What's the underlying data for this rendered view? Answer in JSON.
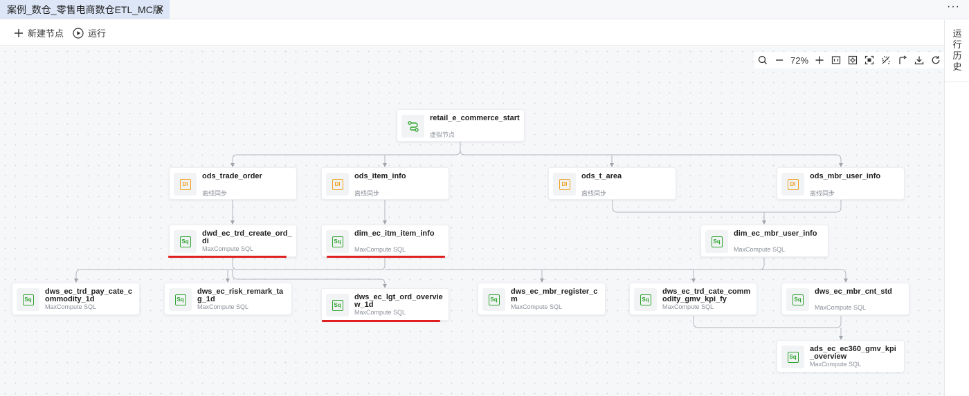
{
  "tab": {
    "title": "案例_数仓_零售电商数仓ETL_MC版",
    "close": "✕"
  },
  "more_label": "···",
  "toolbar": {
    "new_node": "新建节点",
    "run": "运行"
  },
  "right_panel": {
    "history_chars": [
      "运",
      "行",
      "历",
      "史"
    ]
  },
  "zoom": {
    "level": "72%"
  },
  "nodes": {
    "start": {
      "name": "retail_e_commerce_start",
      "type": "虚拟节点",
      "icon": "virtual-node-icon"
    },
    "ods_trade_order": {
      "name": "ods_trade_order",
      "type": "离线同步",
      "icon": "DI"
    },
    "ods_item_info": {
      "name": "ods_item_info",
      "type": "离线同步",
      "icon": "DI"
    },
    "ods_t_area": {
      "name": "ods_t_area",
      "type": "离线同步",
      "icon": "DI"
    },
    "ods_mbr_user_info": {
      "name": "ods_mbr_user_info",
      "type": "离线同步",
      "icon": "DI"
    },
    "dwd_ec_trd_create_ord_di": {
      "name": "dwd_ec_trd_create_ord_di",
      "type": "MaxCompute SQL",
      "icon": "Sq"
    },
    "dim_ec_itm_item_info": {
      "name": "dim_ec_itm_item_info",
      "type": "MaxCompute SQL",
      "icon": "Sq"
    },
    "dim_ec_mbr_user_info": {
      "name": "dim_ec_mbr_user_info",
      "type": "MaxCompute SQL",
      "icon": "Sq"
    },
    "dws_ec_trd_pay_cate_commodity_1d": {
      "name": "dws_ec_trd_pay_cate_commodity_1d",
      "type": "MaxCompute SQL",
      "icon": "Sq"
    },
    "dws_ec_risk_remark_tag_1d": {
      "name": "dws_ec_risk_remark_tag_1d",
      "type": "MaxCompute SQL",
      "icon": "Sq"
    },
    "dws_ec_lgt_ord_overview_1d": {
      "name": "dws_ec_lgt_ord_overview_1d",
      "type": "MaxCompute SQL",
      "icon": "Sq"
    },
    "dws_ec_mbr_register_cm": {
      "name": "dws_ec_mbr_register_cm",
      "type": "MaxCompute SQL",
      "icon": "Sq"
    },
    "dws_ec_trd_cate_commodity_gmv_kpi_fy": {
      "name": "dws_ec_trd_cate_commodity_gmv_kpi_fy",
      "type": "MaxCompute SQL",
      "icon": "Sq"
    },
    "dws_ec_mbr_cnt_std": {
      "name": "dws_ec_mbr_cnt_std",
      "type": "MaxCompute SQL",
      "icon": "Sq"
    },
    "ads_ec_ec360_gmv_kpi_overview": {
      "name": "ads_ec_ec360_gmv_kpi_overview",
      "type": "MaxCompute SQL",
      "icon": "Sq"
    }
  },
  "highlighted_nodes": [
    "dwd_ec_trd_create_ord_di",
    "dim_ec_itm_item_info",
    "dws_ec_lgt_ord_overview_1d"
  ],
  "colors": {
    "tab_active": "#dde6f7",
    "sql_icon": "#2ca32c",
    "sync_icon": "#f0a020",
    "highlight": "#e02020",
    "edge": "#a8acb3"
  }
}
